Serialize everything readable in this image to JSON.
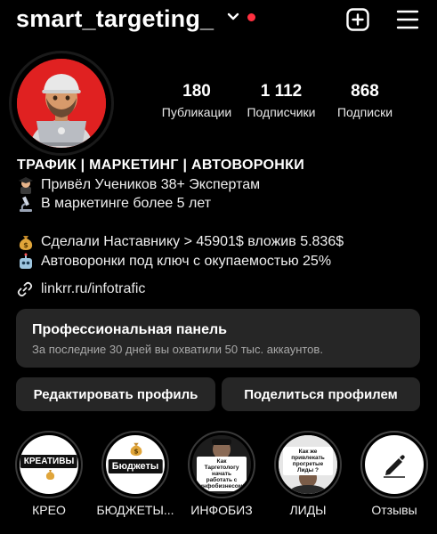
{
  "header": {
    "username": "smart_targeting_",
    "notification_color": "#ff3040",
    "create_icon": "plus-square-icon",
    "menu_icon": "hamburger-menu-icon"
  },
  "profile": {
    "avatar_color": "#e02121",
    "stats": [
      {
        "value": "180",
        "label": "Публикации"
      },
      {
        "value": "1 112",
        "label": "Подписчики"
      },
      {
        "value": "868",
        "label": "Подписки"
      }
    ]
  },
  "bio": {
    "title": "ТРАФИК | МАРКЕТИНГ | АВТОВОРОНКИ",
    "lines": [
      {
        "icon": "student-icon",
        "text": "Привёл Учеников 38+ Экспертам"
      },
      {
        "icon": "microscope-icon",
        "text": "В маркетинге более 5 лет"
      },
      {
        "icon": "money-bag-icon",
        "text": "Сделали Наставнику > 45901$ вложив 5.836$"
      },
      {
        "icon": "robot-icon",
        "text": "Автоворонки под ключ с окупаемостью 25%"
      }
    ],
    "link": "linkrr.ru/infotrafic"
  },
  "pro_panel": {
    "title": "Профессиональная панель",
    "subtitle": "За последние 30 дней вы охватили 50 тыс. аккаунтов."
  },
  "buttons": {
    "edit": "Редактировать профиль",
    "share": "Поделиться профилем"
  },
  "highlights": [
    {
      "caption": "КРЕО",
      "cover_text": "КРЕАТИВЫ"
    },
    {
      "caption": "БЮДЖЕТЫ...",
      "cover_text": "Бюджеты"
    },
    {
      "caption": "ИНФОБИЗ",
      "cover_text": "Как Таргетологу начать работать с инфобизнесом?"
    },
    {
      "caption": "ЛИДЫ",
      "cover_text": "Как же привлекать прогретые Лиды ?"
    },
    {
      "caption": "Отзывы",
      "cover_icon": "pen-icon"
    }
  ]
}
